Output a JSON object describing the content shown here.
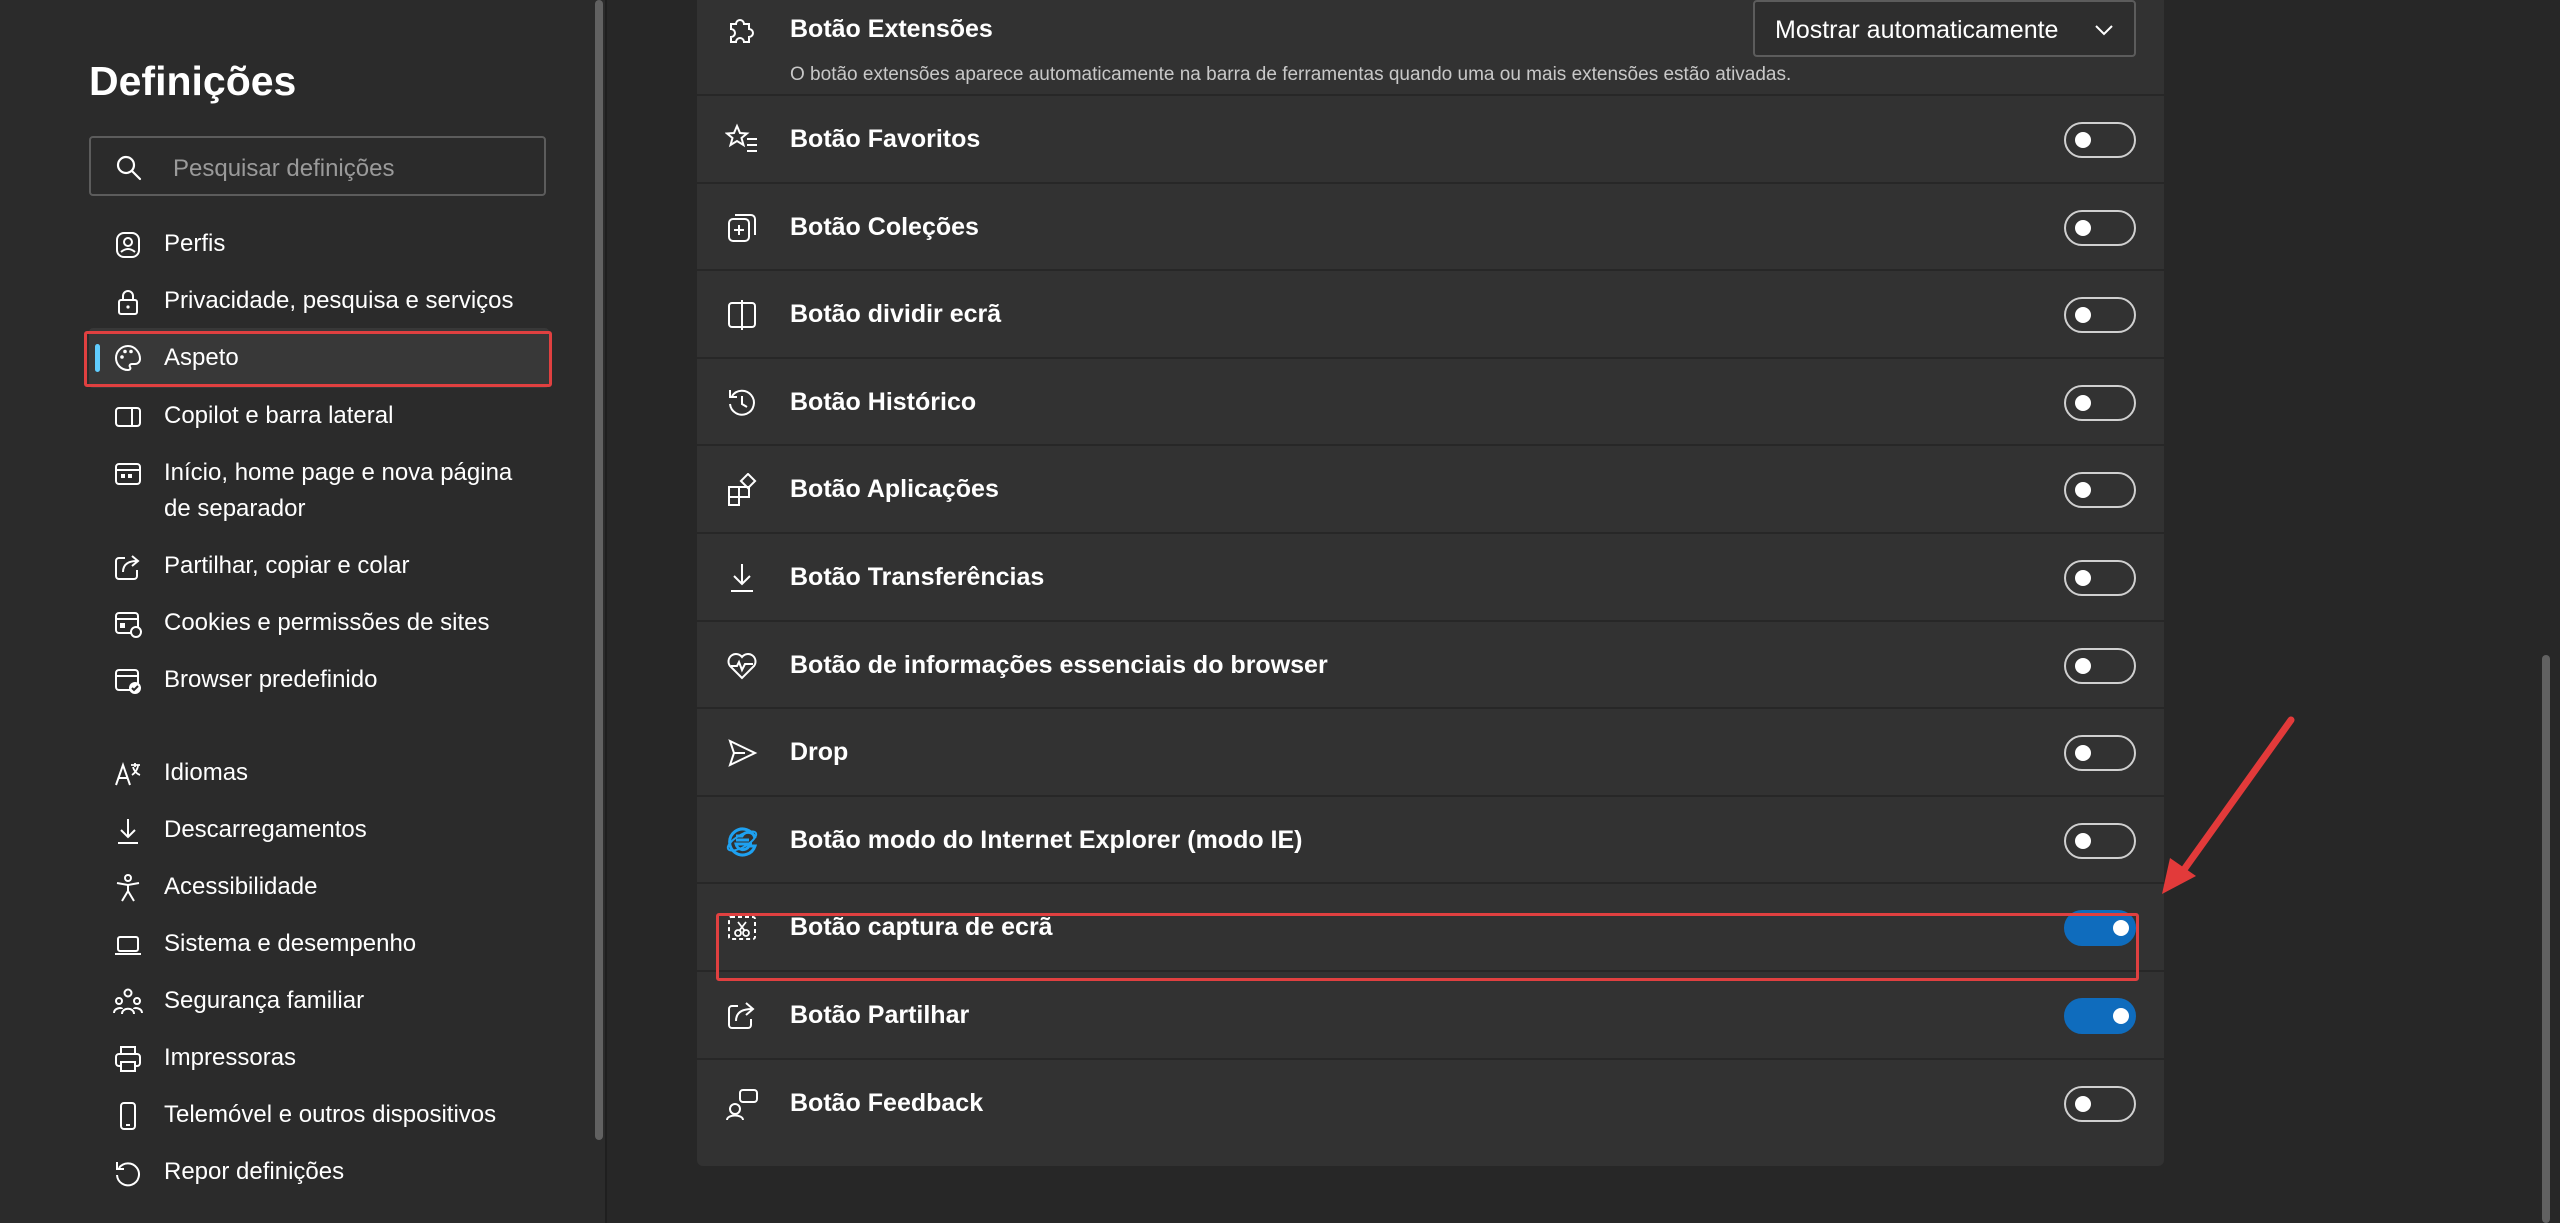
{
  "sidebar": {
    "title": "Definições",
    "search_placeholder": "Pesquisar definições",
    "items": [
      {
        "label": "Perfis",
        "icon": "profile-icon"
      },
      {
        "label": "Privacidade, pesquisa e serviços",
        "icon": "lock-icon"
      },
      {
        "label": "Aspeto",
        "icon": "palette-icon",
        "active": true
      },
      {
        "label": "Copilot e barra lateral",
        "icon": "sidebar-icon"
      },
      {
        "label": "Início, home page e nova página de separador",
        "icon": "home-page-icon"
      },
      {
        "label": "Partilhar, copiar e colar",
        "icon": "share-icon"
      },
      {
        "label": "Cookies e permissões de sites",
        "icon": "cookies-icon"
      },
      {
        "label": "Browser predefinido",
        "icon": "default-browser-icon"
      },
      {
        "label": "Idiomas",
        "icon": "languages-icon"
      },
      {
        "label": "Descarregamentos",
        "icon": "download-icon"
      },
      {
        "label": "Acessibilidade",
        "icon": "accessibility-icon"
      },
      {
        "label": "Sistema e desempenho",
        "icon": "laptop-icon"
      },
      {
        "label": "Segurança familiar",
        "icon": "family-icon"
      },
      {
        "label": "Impressoras",
        "icon": "printer-icon"
      },
      {
        "label": "Telemóvel e outros dispositivos",
        "icon": "phone-icon"
      },
      {
        "label": "Repor definições",
        "icon": "reset-icon"
      }
    ]
  },
  "extensions_row": {
    "label": "Botão Extensões",
    "description": "O botão extensões aparece automaticamente na barra de ferramentas quando uma ou mais extensões estão ativadas.",
    "dropdown_value": "Mostrar automaticamente",
    "icon": "puzzle-icon"
  },
  "toggle_rows": [
    {
      "label": "Botão Favoritos",
      "icon": "favorites-icon",
      "on": false
    },
    {
      "label": "Botão Coleções",
      "icon": "collections-icon",
      "on": false
    },
    {
      "label": "Botão dividir ecrã",
      "icon": "split-screen-icon",
      "on": false
    },
    {
      "label": "Botão Histórico",
      "icon": "history-icon",
      "on": false
    },
    {
      "label": "Botão Aplicações",
      "icon": "apps-icon",
      "on": false
    },
    {
      "label": "Botão Transferências",
      "icon": "download-icon",
      "on": false
    },
    {
      "label": "Botão de informações essenciais do browser",
      "icon": "heart-pulse-icon",
      "on": false
    },
    {
      "label": "Drop",
      "icon": "send-icon",
      "on": false
    },
    {
      "label": "Botão modo do Internet Explorer (modo IE)",
      "icon": "internet-explorer-icon",
      "on": false
    },
    {
      "label": "Botão captura de ecrã",
      "icon": "screenshot-icon",
      "on": true
    },
    {
      "label": "Botão Partilhar",
      "icon": "share-icon",
      "on": true
    },
    {
      "label": "Botão Feedback",
      "icon": "feedback-icon",
      "on": false
    }
  ],
  "colors": {
    "accent": "#0f6cbd",
    "highlight": "#e04040",
    "active_bar": "#60cdff"
  }
}
